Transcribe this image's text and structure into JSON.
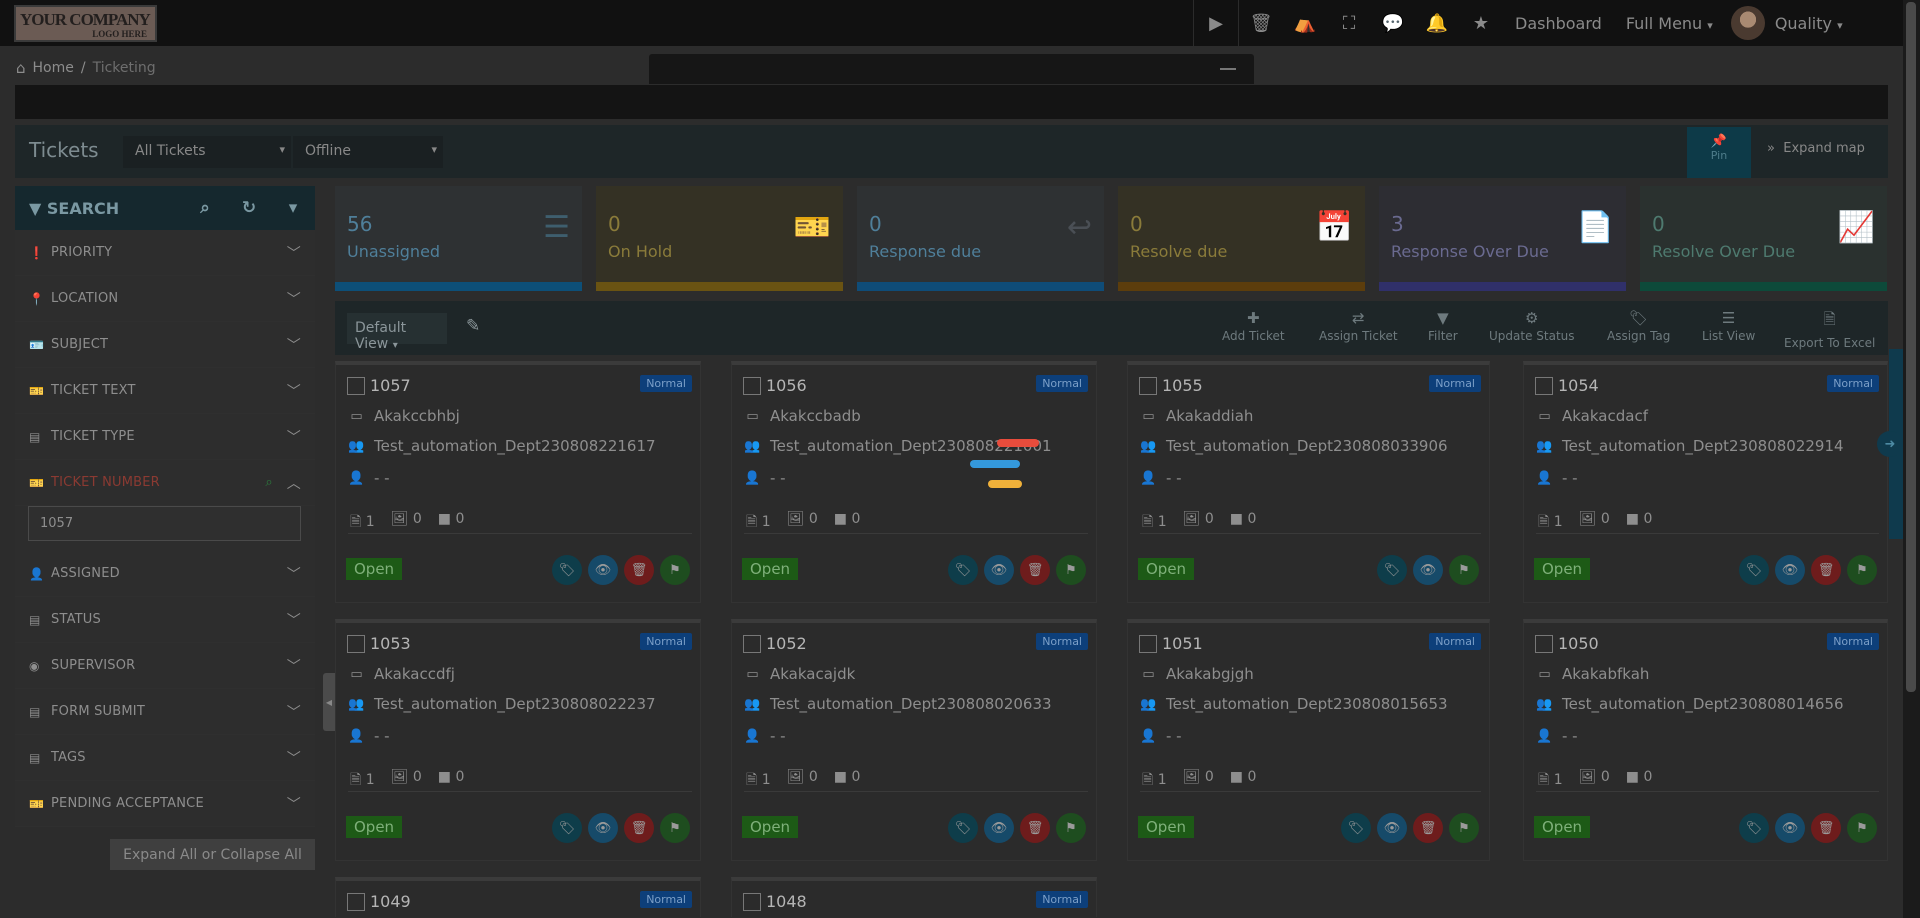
{
  "topbar": {
    "logo_line1": "YOUR COMPANY",
    "logo_line2": "LOGO HERE",
    "dashboard": "Dashboard",
    "full_menu": "Full Menu",
    "user": "Quality"
  },
  "breadcrumb": {
    "home": "Home",
    "separator": "/",
    "current": "Ticketing"
  },
  "header": {
    "title": "Tickets",
    "filter_select": "All Tickets",
    "status_select": "Offline",
    "pin": "Pin",
    "expand_map": "Expand map"
  },
  "sidebar": {
    "search_label": "SEARCH",
    "items": [
      {
        "label": "PRIORITY",
        "icon": "exclamation-circle-icon"
      },
      {
        "label": "LOCATION",
        "icon": "map-pin-icon"
      },
      {
        "label": "SUBJECT",
        "icon": "id-card-icon"
      },
      {
        "label": "TICKET TEXT",
        "icon": "ticket-icon"
      },
      {
        "label": "TICKET TYPE",
        "icon": "form-icon"
      },
      {
        "label": "TICKET NUMBER",
        "icon": "ticket-icon"
      },
      {
        "label": "ASSIGNED",
        "icon": "user-icon"
      },
      {
        "label": "STATUS",
        "icon": "file-icon"
      },
      {
        "label": "SUPERVISOR",
        "icon": "user-circle-icon"
      },
      {
        "label": "FORM SUBMIT",
        "icon": "form-icon"
      },
      {
        "label": "TAGS",
        "icon": "file-icon"
      },
      {
        "label": "PENDING ACCEPTANCE",
        "icon": "ticket-icon"
      }
    ],
    "ticket_number_value": "1057",
    "expand_all": "Expand All or Collapse All"
  },
  "stats": [
    {
      "value": "56",
      "label": "Unassigned",
      "icon": "list-icon",
      "bg": "#2e3133",
      "text": "#4f7f9a",
      "bar": "#0d4f78",
      "iconColor": "#3e5e6e"
    },
    {
      "value": "0",
      "label": "On Hold",
      "icon": "ticket-icon",
      "bg": "#343124",
      "text": "#8a7b3a",
      "bar": "#6a5312",
      "iconColor": "#5a5536"
    },
    {
      "value": "0",
      "label": "Response due",
      "icon": "reply-icon",
      "bg": "#2e3133",
      "text": "#4f7f9a",
      "bar": "#0f4c78",
      "iconColor": "#4a4f55"
    },
    {
      "value": "0",
      "label": "Resolve due",
      "icon": "calendar-check-icon",
      "bg": "#343124",
      "text": "#8a7b3a",
      "bar": "#5c3d0c",
      "iconColor": "#5a5536"
    },
    {
      "value": "3",
      "label": "Response Over Due",
      "icon": "document-icon",
      "bg": "#2d2d33",
      "text": "#6a6a90",
      "bar": "#30306a",
      "iconColor": "#55555a"
    },
    {
      "value": "0",
      "label": "Resolve Over Due",
      "icon": "chart-line-icon",
      "bg": "#2a312f",
      "text": "#4e7a6f",
      "bar": "#0d4a3a",
      "iconColor": "#44514c"
    }
  ],
  "actionbar": {
    "default_view": "Default View",
    "actions": [
      {
        "label": "Add Ticket",
        "icon": "plus-icon"
      },
      {
        "label": "Assign Ticket",
        "icon": "exchange-icon"
      },
      {
        "label": "Filter",
        "icon": "filter-icon"
      },
      {
        "label": "Update Status",
        "icon": "gear-icon"
      },
      {
        "label": "Assign Tag",
        "icon": "tag-icon"
      },
      {
        "label": "List View",
        "icon": "list-icon"
      },
      {
        "label": "Export To Excel",
        "icon": "excel-icon"
      }
    ]
  },
  "tickets": [
    {
      "number": "1057",
      "priority": "Normal",
      "subject": "Akakccbhbj",
      "dept": "Test_automation_Dept230808221617",
      "assignee": "- -",
      "files": "1",
      "images": "0",
      "videos": "0",
      "status": "Open",
      "deletable": true
    },
    {
      "number": "1056",
      "priority": "Normal",
      "subject": "Akakccbadb",
      "dept": "Test_automation_Dept230808221001",
      "assignee": "- -",
      "files": "1",
      "images": "0",
      "videos": "0",
      "status": "Open",
      "deletable": true
    },
    {
      "number": "1055",
      "priority": "Normal",
      "subject": "Akakaddiah",
      "dept": "Test_automation_Dept230808033906",
      "assignee": "- -",
      "files": "1",
      "images": "0",
      "videos": "0",
      "status": "Open",
      "deletable": false
    },
    {
      "number": "1054",
      "priority": "Normal",
      "subject": "Akakacdacf",
      "dept": "Test_automation_Dept230808022914",
      "assignee": "- -",
      "files": "1",
      "images": "0",
      "videos": "0",
      "status": "Open",
      "deletable": true
    },
    {
      "number": "1053",
      "priority": "Normal",
      "subject": "Akakaccdfj",
      "dept": "Test_automation_Dept230808022237",
      "assignee": "- -",
      "files": "1",
      "images": "0",
      "videos": "0",
      "status": "Open",
      "deletable": true
    },
    {
      "number": "1052",
      "priority": "Normal",
      "subject": "Akakacajdk",
      "dept": "Test_automation_Dept230808020633",
      "assignee": "- -",
      "files": "1",
      "images": "0",
      "videos": "0",
      "status": "Open",
      "deletable": true
    },
    {
      "number": "1051",
      "priority": "Normal",
      "subject": "Akakabgjgh",
      "dept": "Test_automation_Dept230808015653",
      "assignee": "- -",
      "files": "1",
      "images": "0",
      "videos": "0",
      "status": "Open",
      "deletable": true
    },
    {
      "number": "1050",
      "priority": "Normal",
      "subject": "Akakabfkah",
      "dept": "Test_automation_Dept230808014656",
      "assignee": "- -",
      "files": "1",
      "images": "0",
      "videos": "0",
      "status": "Open",
      "deletable": true
    },
    {
      "number": "1049",
      "priority": "Normal"
    },
    {
      "number": "1048",
      "priority": "Normal"
    }
  ],
  "loader_colors": [
    "#e74c3c",
    "#3498db",
    "#f0b13a"
  ]
}
